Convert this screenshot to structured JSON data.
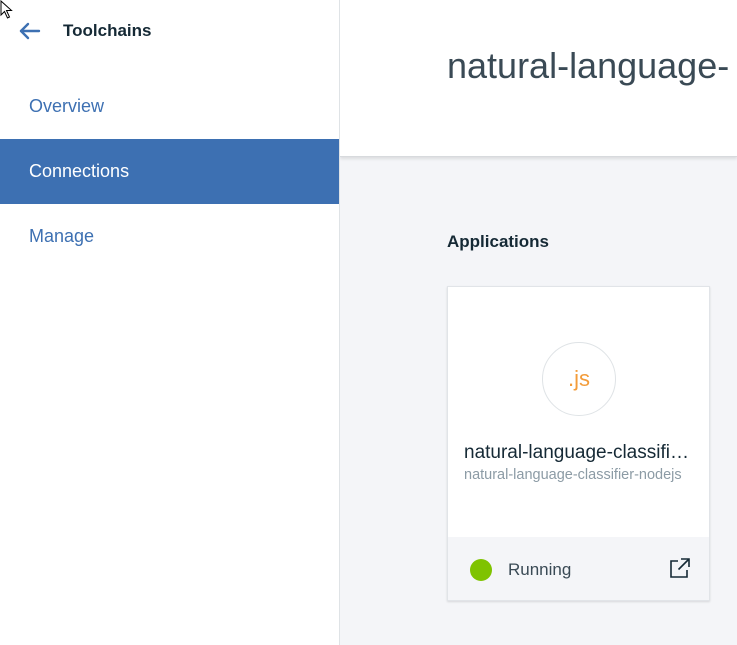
{
  "sidebar": {
    "title": "Toolchains",
    "back_icon": "arrow-left-icon",
    "nav_items": [
      {
        "label": "Overview",
        "active": false
      },
      {
        "label": "Connections",
        "active": true
      },
      {
        "label": "Manage",
        "active": false
      }
    ]
  },
  "main": {
    "title": "natural-language-",
    "section_title": "Applications",
    "app_card": {
      "logo_text": ".js",
      "name": "natural-language-classifier-nodejs",
      "subtitle": "natural-language-classifier-nodejs",
      "status": "Running",
      "status_color": "#7fc300",
      "launch_icon": "external-link-icon"
    }
  },
  "colors": {
    "accent": "#3d70b2",
    "logo": "#f39c3a"
  }
}
